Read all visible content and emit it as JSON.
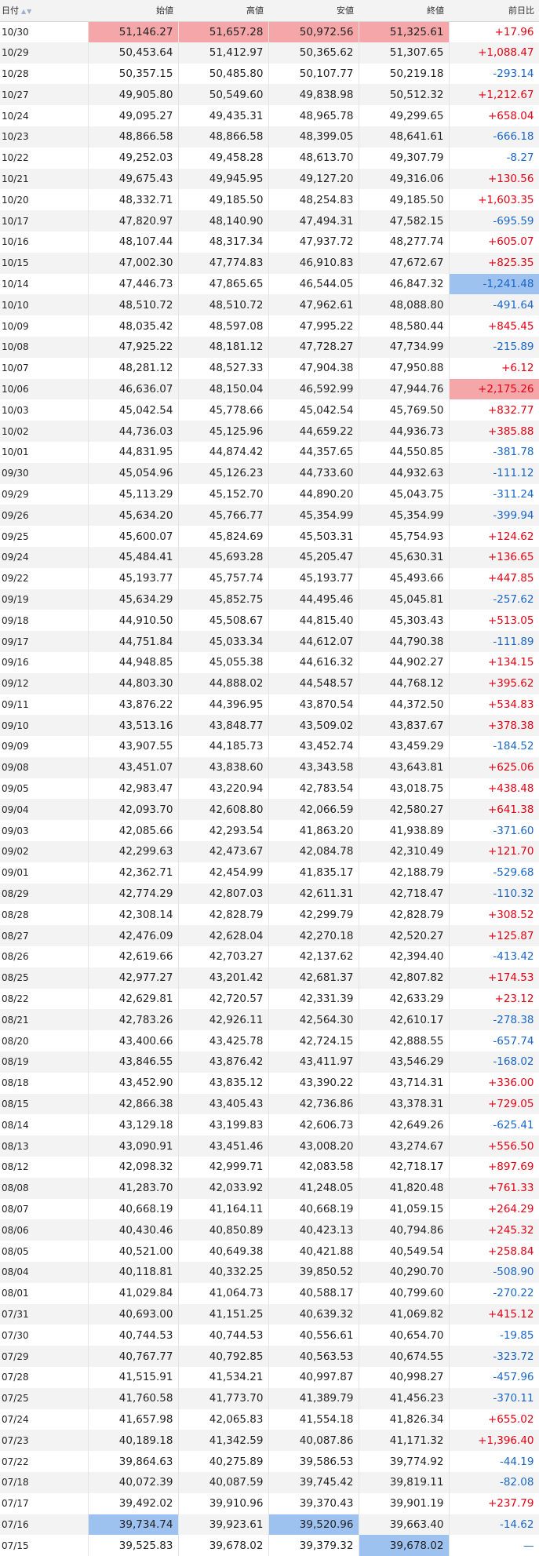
{
  "headers": [
    "日付",
    "始値",
    "高値",
    "安値",
    "終値",
    "前日比"
  ],
  "colors": {
    "positive": "#e60012",
    "negative": "#1a66c8",
    "highlight_high": "#f5a6a9",
    "highlight_low": "#9dc2ef"
  },
  "rows": [
    [
      "10/30",
      "51,146.27",
      "51,657.28",
      "50,972.56",
      "51,325.61",
      "+17.96"
    ],
    [
      "10/29",
      "50,453.64",
      "51,412.97",
      "50,365.62",
      "51,307.65",
      "+1,088.47"
    ],
    [
      "10/28",
      "50,357.15",
      "50,485.80",
      "50,107.77",
      "50,219.18",
      "-293.14"
    ],
    [
      "10/27",
      "49,905.80",
      "50,549.60",
      "49,838.98",
      "50,512.32",
      "+1,212.67"
    ],
    [
      "10/24",
      "49,095.27",
      "49,435.31",
      "48,965.78",
      "49,299.65",
      "+658.04"
    ],
    [
      "10/23",
      "48,866.58",
      "48,866.58",
      "48,399.05",
      "48,641.61",
      "-666.18"
    ],
    [
      "10/22",
      "49,252.03",
      "49,458.28",
      "48,613.70",
      "49,307.79",
      "-8.27"
    ],
    [
      "10/21",
      "49,675.43",
      "49,945.95",
      "49,127.20",
      "49,316.06",
      "+130.56"
    ],
    [
      "10/20",
      "48,332.71",
      "49,185.50",
      "48,254.83",
      "49,185.50",
      "+1,603.35"
    ],
    [
      "10/17",
      "47,820.97",
      "48,140.90",
      "47,494.31",
      "47,582.15",
      "-695.59"
    ],
    [
      "10/16",
      "48,107.44",
      "48,317.34",
      "47,937.72",
      "48,277.74",
      "+605.07"
    ],
    [
      "10/15",
      "47,002.30",
      "47,774.83",
      "46,910.83",
      "47,672.67",
      "+825.35"
    ],
    [
      "10/14",
      "47,446.73",
      "47,865.65",
      "46,544.05",
      "46,847.32",
      "-1,241.48"
    ],
    [
      "10/10",
      "48,510.72",
      "48,510.72",
      "47,962.61",
      "48,088.80",
      "-491.64"
    ],
    [
      "10/09",
      "48,035.42",
      "48,597.08",
      "47,995.22",
      "48,580.44",
      "+845.45"
    ],
    [
      "10/08",
      "47,925.22",
      "48,181.12",
      "47,728.27",
      "47,734.99",
      "-215.89"
    ],
    [
      "10/07",
      "48,281.12",
      "48,527.33",
      "47,904.38",
      "47,950.88",
      "+6.12"
    ],
    [
      "10/06",
      "46,636.07",
      "48,150.04",
      "46,592.99",
      "47,944.76",
      "+2,175.26"
    ],
    [
      "10/03",
      "45,042.54",
      "45,778.66",
      "45,042.54",
      "45,769.50",
      "+832.77"
    ],
    [
      "10/02",
      "44,736.03",
      "45,125.96",
      "44,659.22",
      "44,936.73",
      "+385.88"
    ],
    [
      "10/01",
      "44,831.95",
      "44,874.42",
      "44,357.65",
      "44,550.85",
      "-381.78"
    ],
    [
      "09/30",
      "45,054.96",
      "45,126.23",
      "44,733.60",
      "44,932.63",
      "-111.12"
    ],
    [
      "09/29",
      "45,113.29",
      "45,152.70",
      "44,890.20",
      "45,043.75",
      "-311.24"
    ],
    [
      "09/26",
      "45,634.20",
      "45,766.77",
      "45,354.99",
      "45,354.99",
      "-399.94"
    ],
    [
      "09/25",
      "45,600.07",
      "45,824.69",
      "45,503.31",
      "45,754.93",
      "+124.62"
    ],
    [
      "09/24",
      "45,484.41",
      "45,693.28",
      "45,205.47",
      "45,630.31",
      "+136.65"
    ],
    [
      "09/22",
      "45,193.77",
      "45,757.74",
      "45,193.77",
      "45,493.66",
      "+447.85"
    ],
    [
      "09/19",
      "45,634.29",
      "45,852.75",
      "44,495.46",
      "45,045.81",
      "-257.62"
    ],
    [
      "09/18",
      "44,910.50",
      "45,508.67",
      "44,815.40",
      "45,303.43",
      "+513.05"
    ],
    [
      "09/17",
      "44,751.84",
      "45,033.34",
      "44,612.07",
      "44,790.38",
      "-111.89"
    ],
    [
      "09/16",
      "44,948.85",
      "45,055.38",
      "44,616.32",
      "44,902.27",
      "+134.15"
    ],
    [
      "09/12",
      "44,803.30",
      "44,888.02",
      "44,548.57",
      "44,768.12",
      "+395.62"
    ],
    [
      "09/11",
      "43,876.22",
      "44,396.95",
      "43,870.54",
      "44,372.50",
      "+534.83"
    ],
    [
      "09/10",
      "43,513.16",
      "43,848.77",
      "43,509.02",
      "43,837.67",
      "+378.38"
    ],
    [
      "09/09",
      "43,907.55",
      "44,185.73",
      "43,452.74",
      "43,459.29",
      "-184.52"
    ],
    [
      "09/08",
      "43,451.07",
      "43,838.60",
      "43,343.58",
      "43,643.81",
      "+625.06"
    ],
    [
      "09/05",
      "42,983.47",
      "43,220.94",
      "42,783.54",
      "43,018.75",
      "+438.48"
    ],
    [
      "09/04",
      "42,093.70",
      "42,608.80",
      "42,066.59",
      "42,580.27",
      "+641.38"
    ],
    [
      "09/03",
      "42,085.66",
      "42,293.54",
      "41,863.20",
      "41,938.89",
      "-371.60"
    ],
    [
      "09/02",
      "42,299.63",
      "42,473.67",
      "42,084.78",
      "42,310.49",
      "+121.70"
    ],
    [
      "09/01",
      "42,362.71",
      "42,454.99",
      "41,835.17",
      "42,188.79",
      "-529.68"
    ],
    [
      "08/29",
      "42,774.29",
      "42,807.03",
      "42,611.31",
      "42,718.47",
      "-110.32"
    ],
    [
      "08/28",
      "42,308.14",
      "42,828.79",
      "42,299.79",
      "42,828.79",
      "+308.52"
    ],
    [
      "08/27",
      "42,476.09",
      "42,628.04",
      "42,270.18",
      "42,520.27",
      "+125.87"
    ],
    [
      "08/26",
      "42,619.66",
      "42,703.27",
      "42,137.62",
      "42,394.40",
      "-413.42"
    ],
    [
      "08/25",
      "42,977.27",
      "43,201.42",
      "42,681.37",
      "42,807.82",
      "+174.53"
    ],
    [
      "08/22",
      "42,629.81",
      "42,720.57",
      "42,331.39",
      "42,633.29",
      "+23.12"
    ],
    [
      "08/21",
      "42,783.26",
      "42,926.11",
      "42,564.30",
      "42,610.17",
      "-278.38"
    ],
    [
      "08/20",
      "43,400.66",
      "43,425.78",
      "42,724.15",
      "42,888.55",
      "-657.74"
    ],
    [
      "08/19",
      "43,846.55",
      "43,876.42",
      "43,411.97",
      "43,546.29",
      "-168.02"
    ],
    [
      "08/18",
      "43,452.90",
      "43,835.12",
      "43,390.22",
      "43,714.31",
      "+336.00"
    ],
    [
      "08/15",
      "42,866.38",
      "43,405.43",
      "42,736.86",
      "43,378.31",
      "+729.05"
    ],
    [
      "08/14",
      "43,129.18",
      "43,199.83",
      "42,606.73",
      "42,649.26",
      "-625.41"
    ],
    [
      "08/13",
      "43,090.91",
      "43,451.46",
      "43,008.20",
      "43,274.67",
      "+556.50"
    ],
    [
      "08/12",
      "42,098.32",
      "42,999.71",
      "42,083.58",
      "42,718.17",
      "+897.69"
    ],
    [
      "08/08",
      "41,283.70",
      "42,033.92",
      "41,248.05",
      "41,820.48",
      "+761.33"
    ],
    [
      "08/07",
      "40,668.19",
      "41,164.11",
      "40,668.19",
      "41,059.15",
      "+264.29"
    ],
    [
      "08/06",
      "40,430.46",
      "40,850.89",
      "40,423.13",
      "40,794.86",
      "+245.32"
    ],
    [
      "08/05",
      "40,521.00",
      "40,649.38",
      "40,421.88",
      "40,549.54",
      "+258.84"
    ],
    [
      "08/04",
      "40,118.81",
      "40,332.25",
      "39,850.52",
      "40,290.70",
      "-508.90"
    ],
    [
      "08/01",
      "41,029.84",
      "41,064.73",
      "40,588.17",
      "40,799.60",
      "-270.22"
    ],
    [
      "07/31",
      "40,693.00",
      "41,151.25",
      "40,639.32",
      "41,069.82",
      "+415.12"
    ],
    [
      "07/30",
      "40,744.53",
      "40,744.53",
      "40,556.61",
      "40,654.70",
      "-19.85"
    ],
    [
      "07/29",
      "40,767.77",
      "40,792.85",
      "40,563.53",
      "40,674.55",
      "-323.72"
    ],
    [
      "07/28",
      "41,515.91",
      "41,534.21",
      "40,997.87",
      "40,998.27",
      "-457.96"
    ],
    [
      "07/25",
      "41,760.58",
      "41,773.70",
      "41,389.79",
      "41,456.23",
      "-370.11"
    ],
    [
      "07/24",
      "41,657.98",
      "42,065.83",
      "41,554.18",
      "41,826.34",
      "+655.02"
    ],
    [
      "07/23",
      "40,189.18",
      "41,342.59",
      "40,087.86",
      "41,171.32",
      "+1,396.40"
    ],
    [
      "07/22",
      "39,864.63",
      "40,275.89",
      "39,586.53",
      "39,774.92",
      "-44.19"
    ],
    [
      "07/18",
      "40,072.39",
      "40,087.59",
      "39,745.42",
      "39,819.11",
      "-82.08"
    ],
    [
      "07/17",
      "39,492.02",
      "39,910.96",
      "39,370.43",
      "39,901.19",
      "+237.79"
    ],
    [
      "07/16",
      "39,734.74",
      "39,923.61",
      "39,520.96",
      "39,663.40",
      "-14.62"
    ],
    [
      "07/15",
      "39,525.83",
      "39,678.02",
      "39,379.32",
      "39,678.02",
      "—"
    ]
  ],
  "highlights": [
    {
      "row": 0,
      "col": 1,
      "kind": "hi"
    },
    {
      "row": 0,
      "col": 2,
      "kind": "hi"
    },
    {
      "row": 0,
      "col": 3,
      "kind": "hi"
    },
    {
      "row": 0,
      "col": 4,
      "kind": "hi"
    },
    {
      "row": 12,
      "col": 5,
      "kind": "lo"
    },
    {
      "row": 17,
      "col": 5,
      "kind": "hi"
    },
    {
      "row": 71,
      "col": 1,
      "kind": "lo"
    },
    {
      "row": 71,
      "col": 3,
      "kind": "lo"
    },
    {
      "row": 72,
      "col": 4,
      "kind": "lo"
    },
    {
      "row": 73,
      "col": 2,
      "kind": "lo"
    }
  ]
}
